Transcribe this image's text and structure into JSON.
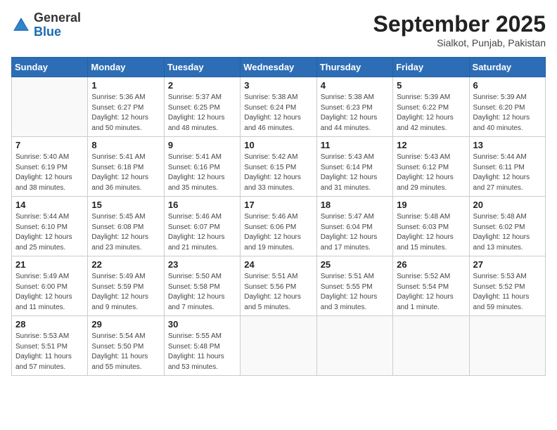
{
  "header": {
    "logo_general": "General",
    "logo_blue": "Blue",
    "month_year": "September 2025",
    "location": "Sialkot, Punjab, Pakistan"
  },
  "days_of_week": [
    "Sunday",
    "Monday",
    "Tuesday",
    "Wednesday",
    "Thursday",
    "Friday",
    "Saturday"
  ],
  "weeks": [
    [
      {
        "day": "",
        "sunrise": "",
        "sunset": "",
        "daylight": ""
      },
      {
        "day": "1",
        "sunrise": "Sunrise: 5:36 AM",
        "sunset": "Sunset: 6:27 PM",
        "daylight": "Daylight: 12 hours and 50 minutes."
      },
      {
        "day": "2",
        "sunrise": "Sunrise: 5:37 AM",
        "sunset": "Sunset: 6:25 PM",
        "daylight": "Daylight: 12 hours and 48 minutes."
      },
      {
        "day": "3",
        "sunrise": "Sunrise: 5:38 AM",
        "sunset": "Sunset: 6:24 PM",
        "daylight": "Daylight: 12 hours and 46 minutes."
      },
      {
        "day": "4",
        "sunrise": "Sunrise: 5:38 AM",
        "sunset": "Sunset: 6:23 PM",
        "daylight": "Daylight: 12 hours and 44 minutes."
      },
      {
        "day": "5",
        "sunrise": "Sunrise: 5:39 AM",
        "sunset": "Sunset: 6:22 PM",
        "daylight": "Daylight: 12 hours and 42 minutes."
      },
      {
        "day": "6",
        "sunrise": "Sunrise: 5:39 AM",
        "sunset": "Sunset: 6:20 PM",
        "daylight": "Daylight: 12 hours and 40 minutes."
      }
    ],
    [
      {
        "day": "7",
        "sunrise": "Sunrise: 5:40 AM",
        "sunset": "Sunset: 6:19 PM",
        "daylight": "Daylight: 12 hours and 38 minutes."
      },
      {
        "day": "8",
        "sunrise": "Sunrise: 5:41 AM",
        "sunset": "Sunset: 6:18 PM",
        "daylight": "Daylight: 12 hours and 36 minutes."
      },
      {
        "day": "9",
        "sunrise": "Sunrise: 5:41 AM",
        "sunset": "Sunset: 6:16 PM",
        "daylight": "Daylight: 12 hours and 35 minutes."
      },
      {
        "day": "10",
        "sunrise": "Sunrise: 5:42 AM",
        "sunset": "Sunset: 6:15 PM",
        "daylight": "Daylight: 12 hours and 33 minutes."
      },
      {
        "day": "11",
        "sunrise": "Sunrise: 5:43 AM",
        "sunset": "Sunset: 6:14 PM",
        "daylight": "Daylight: 12 hours and 31 minutes."
      },
      {
        "day": "12",
        "sunrise": "Sunrise: 5:43 AM",
        "sunset": "Sunset: 6:12 PM",
        "daylight": "Daylight: 12 hours and 29 minutes."
      },
      {
        "day": "13",
        "sunrise": "Sunrise: 5:44 AM",
        "sunset": "Sunset: 6:11 PM",
        "daylight": "Daylight: 12 hours and 27 minutes."
      }
    ],
    [
      {
        "day": "14",
        "sunrise": "Sunrise: 5:44 AM",
        "sunset": "Sunset: 6:10 PM",
        "daylight": "Daylight: 12 hours and 25 minutes."
      },
      {
        "day": "15",
        "sunrise": "Sunrise: 5:45 AM",
        "sunset": "Sunset: 6:08 PM",
        "daylight": "Daylight: 12 hours and 23 minutes."
      },
      {
        "day": "16",
        "sunrise": "Sunrise: 5:46 AM",
        "sunset": "Sunset: 6:07 PM",
        "daylight": "Daylight: 12 hours and 21 minutes."
      },
      {
        "day": "17",
        "sunrise": "Sunrise: 5:46 AM",
        "sunset": "Sunset: 6:06 PM",
        "daylight": "Daylight: 12 hours and 19 minutes."
      },
      {
        "day": "18",
        "sunrise": "Sunrise: 5:47 AM",
        "sunset": "Sunset: 6:04 PM",
        "daylight": "Daylight: 12 hours and 17 minutes."
      },
      {
        "day": "19",
        "sunrise": "Sunrise: 5:48 AM",
        "sunset": "Sunset: 6:03 PM",
        "daylight": "Daylight: 12 hours and 15 minutes."
      },
      {
        "day": "20",
        "sunrise": "Sunrise: 5:48 AM",
        "sunset": "Sunset: 6:02 PM",
        "daylight": "Daylight: 12 hours and 13 minutes."
      }
    ],
    [
      {
        "day": "21",
        "sunrise": "Sunrise: 5:49 AM",
        "sunset": "Sunset: 6:00 PM",
        "daylight": "Daylight: 12 hours and 11 minutes."
      },
      {
        "day": "22",
        "sunrise": "Sunrise: 5:49 AM",
        "sunset": "Sunset: 5:59 PM",
        "daylight": "Daylight: 12 hours and 9 minutes."
      },
      {
        "day": "23",
        "sunrise": "Sunrise: 5:50 AM",
        "sunset": "Sunset: 5:58 PM",
        "daylight": "Daylight: 12 hours and 7 minutes."
      },
      {
        "day": "24",
        "sunrise": "Sunrise: 5:51 AM",
        "sunset": "Sunset: 5:56 PM",
        "daylight": "Daylight: 12 hours and 5 minutes."
      },
      {
        "day": "25",
        "sunrise": "Sunrise: 5:51 AM",
        "sunset": "Sunset: 5:55 PM",
        "daylight": "Daylight: 12 hours and 3 minutes."
      },
      {
        "day": "26",
        "sunrise": "Sunrise: 5:52 AM",
        "sunset": "Sunset: 5:54 PM",
        "daylight": "Daylight: 12 hours and 1 minute."
      },
      {
        "day": "27",
        "sunrise": "Sunrise: 5:53 AM",
        "sunset": "Sunset: 5:52 PM",
        "daylight": "Daylight: 11 hours and 59 minutes."
      }
    ],
    [
      {
        "day": "28",
        "sunrise": "Sunrise: 5:53 AM",
        "sunset": "Sunset: 5:51 PM",
        "daylight": "Daylight: 11 hours and 57 minutes."
      },
      {
        "day": "29",
        "sunrise": "Sunrise: 5:54 AM",
        "sunset": "Sunset: 5:50 PM",
        "daylight": "Daylight: 11 hours and 55 minutes."
      },
      {
        "day": "30",
        "sunrise": "Sunrise: 5:55 AM",
        "sunset": "Sunset: 5:48 PM",
        "daylight": "Daylight: 11 hours and 53 minutes."
      },
      {
        "day": "",
        "sunrise": "",
        "sunset": "",
        "daylight": ""
      },
      {
        "day": "",
        "sunrise": "",
        "sunset": "",
        "daylight": ""
      },
      {
        "day": "",
        "sunrise": "",
        "sunset": "",
        "daylight": ""
      },
      {
        "day": "",
        "sunrise": "",
        "sunset": "",
        "daylight": ""
      }
    ]
  ]
}
